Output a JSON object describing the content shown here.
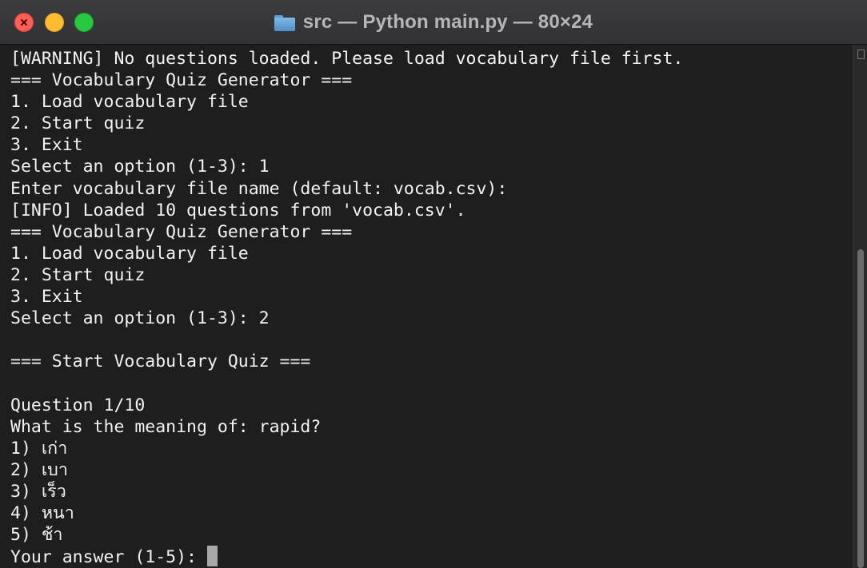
{
  "window": {
    "folder_icon": "folder-icon",
    "title": "src — Python main.py — 80×24"
  },
  "terminal": {
    "lines": [
      "[WARNING] No questions loaded. Please load vocabulary file first.",
      "=== Vocabulary Quiz Generator ===",
      "1. Load vocabulary file",
      "2. Start quiz",
      "3. Exit",
      "Select an option (1-3): 1",
      "Enter vocabulary file name (default: vocab.csv):",
      "[INFO] Loaded 10 questions from 'vocab.csv'.",
      "=== Vocabulary Quiz Generator ===",
      "1. Load vocabulary file",
      "2. Start quiz",
      "3. Exit",
      "Select an option (1-3): 2",
      "",
      "=== Start Vocabulary Quiz ===",
      "",
      "Question 1/10",
      "What is the meaning of: rapid?",
      "1) เก่า",
      "2) เบา",
      "3) เร็ว",
      "4) หนา",
      "5) ช้า"
    ],
    "prompt": "Your answer (1-5): "
  },
  "colors": {
    "background": "#1e1e1e",
    "text": "#f2f2f2",
    "titlebar": "#363638",
    "close": "#fe5f57",
    "minimize": "#febc2e",
    "maximize": "#28c840"
  }
}
